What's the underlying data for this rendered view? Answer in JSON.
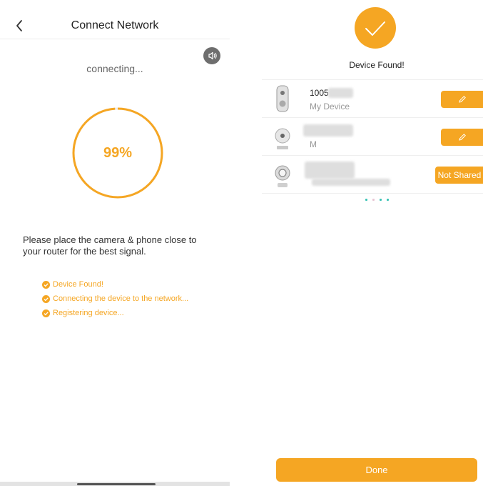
{
  "left_screen": {
    "title": "Connect Network",
    "status": "connecting...",
    "progress_percent": 99,
    "progress_label": "99%",
    "hint": "Please place the camera & phone close to your router for the best signal.",
    "steps": [
      {
        "label": "Device Found!",
        "done": true
      },
      {
        "label": "Connecting the device to the network...",
        "done": true
      },
      {
        "label": "Registering device...",
        "done": true
      }
    ],
    "icons": {
      "back": "back-chevron-icon",
      "speaker": "speaker-icon",
      "check": "check-circle-icon"
    }
  },
  "right_screen": {
    "title": "Device Found!",
    "devices": [
      {
        "name": "1005",
        "subtitle": "My Device",
        "action": "edit",
        "icon": "doorbell-camera-icon"
      },
      {
        "name": "",
        "subtitle": "M",
        "action": "edit",
        "icon": "cube-camera-icon"
      },
      {
        "name": "",
        "subtitle": "",
        "action_label": "Not Shared",
        "icon": "pan-tilt-camera-icon"
      }
    ],
    "done_label": "Done",
    "icons": {
      "found": "check-badge-icon",
      "edit": "pencil-icon"
    }
  },
  "colors": {
    "accent": "#f5a623",
    "text": "#222222",
    "muted": "#999999"
  }
}
